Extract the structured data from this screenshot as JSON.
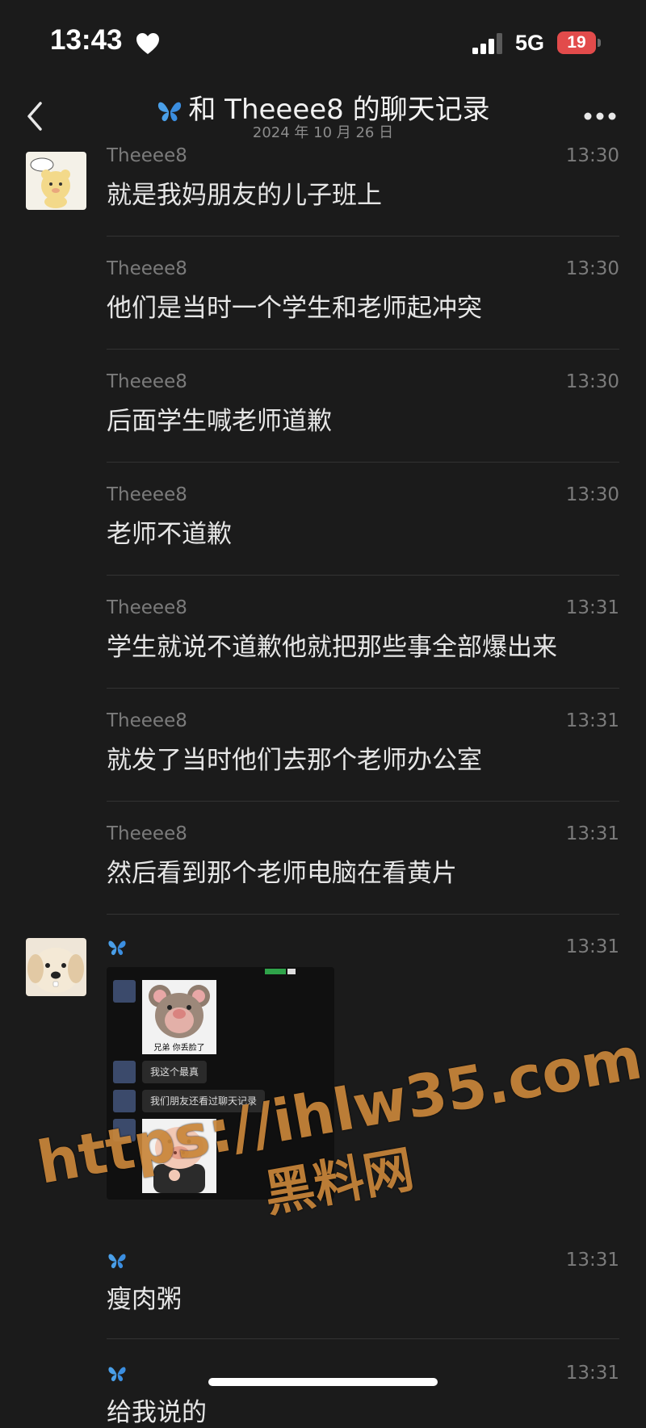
{
  "status": {
    "time": "13:43",
    "network": "5G",
    "battery": "19"
  },
  "nav": {
    "title": "和 Theeee8 的聊天记录",
    "date": "2024 年 10 月 26 日"
  },
  "messages": [
    {
      "sender": "Theeee8",
      "time": "13:30",
      "text": "就是我妈朋友的儿子班上"
    },
    {
      "sender": "Theeee8",
      "time": "13:30",
      "text": "他们是当时一个学生和老师起冲突"
    },
    {
      "sender": "Theeee8",
      "time": "13:30",
      "text": "后面学生喊老师道歉"
    },
    {
      "sender": "Theeee8",
      "time": "13:30",
      "text": "老师不道歉"
    },
    {
      "sender": "Theeee8",
      "time": "13:31",
      "text": "学生就说不道歉他就把那些事全部爆出来"
    },
    {
      "sender": "Theeee8",
      "time": "13:31",
      "text": "就发了当时他们去那个老师办公室"
    },
    {
      "sender": "Theeee8",
      "time": "13:31",
      "text": "然后看到那个老师电脑在看黄片"
    }
  ],
  "image_message": {
    "time": "13:31",
    "sticker1_caption": "兄弟 你丢脸了",
    "bubble1": "我这个最真",
    "bubble2": "我们朋友还看过聊天记录"
  },
  "later_messages": [
    {
      "time": "13:31",
      "text": "瘦肉粥"
    },
    {
      "time": "13:31",
      "text": "给我说的"
    }
  ],
  "watermark": {
    "url": "https://ihlw35.com",
    "label": "黑料网"
  },
  "colors": {
    "background": "#1b1b1b",
    "watermark": "#c9863a",
    "battery": "#e24b4b"
  }
}
